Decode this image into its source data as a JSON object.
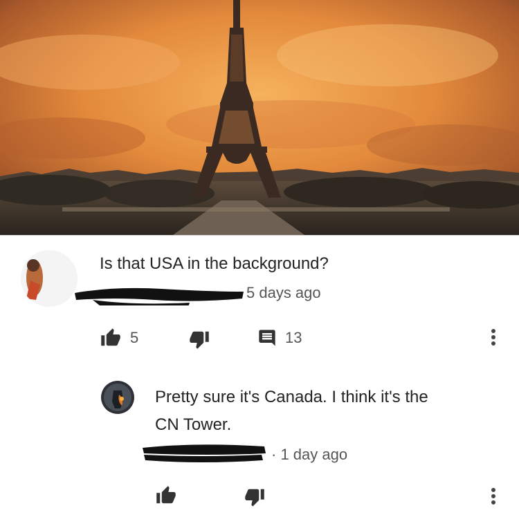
{
  "comment": {
    "text": "Is that USA in the background?",
    "author": "",
    "time": "5 days ago",
    "likes": "5",
    "replies": "13"
  },
  "reply": {
    "text_line1": "Pretty sure it's Canada. I think it's the",
    "text_line2": "CN Tower.",
    "author": "",
    "time": "· 1 day ago"
  },
  "icons": {
    "like": "thumb-up-icon",
    "dislike": "thumb-down-icon",
    "reply": "comment-icon",
    "more": "more-vert-icon"
  },
  "colors": {
    "sky": "#e38a3c",
    "text": "#222222",
    "meta": "#555555",
    "icon": "#333333"
  }
}
